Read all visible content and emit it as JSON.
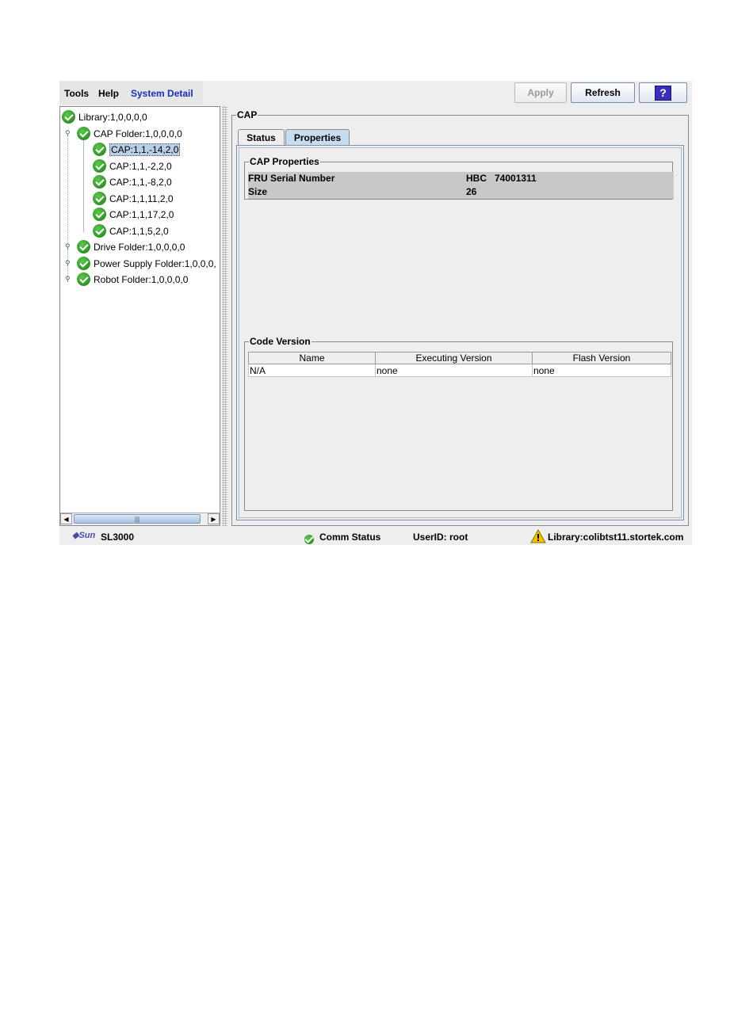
{
  "menu": {
    "tools": "Tools",
    "help": "Help",
    "system_detail": "System Detail"
  },
  "toolbar": {
    "apply": "Apply",
    "refresh": "Refresh",
    "help_glyph": "?"
  },
  "tree": {
    "library": "Library:1,0,0,0,0",
    "cap_folder": "CAP Folder:1,0,0,0,0",
    "caps": [
      "CAP:1,1,-14,2,0",
      "CAP:1,1,-2,2,0",
      "CAP:1,1,-8,2,0",
      "CAP:1,1,11,2,0",
      "CAP:1,1,17,2,0",
      "CAP:1,1,5,2,0"
    ],
    "selected": "CAP:1,1,-14,2,0",
    "drive_folder": "Drive Folder:1,0,0,0,0",
    "power_folder": "Power Supply Folder:1,0,0,0,",
    "robot_folder": "Robot Folder:1,0,0,0,0",
    "scroll_grip": "|||"
  },
  "detail": {
    "title": "CAP",
    "tabs": [
      "Status",
      "Properties"
    ],
    "active_tab": "Properties",
    "properties": {
      "legend": "CAP Properties",
      "rows": [
        {
          "label": "FRU Serial Number",
          "value": "HBC   74001311"
        },
        {
          "label": "Size",
          "value": "26"
        }
      ]
    },
    "code_version": {
      "legend": "Code Version",
      "columns": [
        "Name",
        "Executing Version",
        "Flash Version"
      ],
      "rows": [
        [
          "N/A",
          "none",
          "none"
        ]
      ]
    }
  },
  "statusbar": {
    "brand": "Sun",
    "product": "SL3000",
    "comm_status": "Comm Status",
    "user": "UserID: root",
    "library": "Library:colibtst11.stortek.com"
  },
  "colors": {
    "accent": "#1a2fb8",
    "selection": "#b8cfe5",
    "tab_active": "#c9dcef",
    "ok_green": "#2e9a24",
    "warning": "#f2c200"
  },
  "icons": {
    "status_ok": "green-check-icon",
    "warning": "warning-triangle-icon",
    "help": "help-icon",
    "logo": "sun-logo-icon"
  }
}
